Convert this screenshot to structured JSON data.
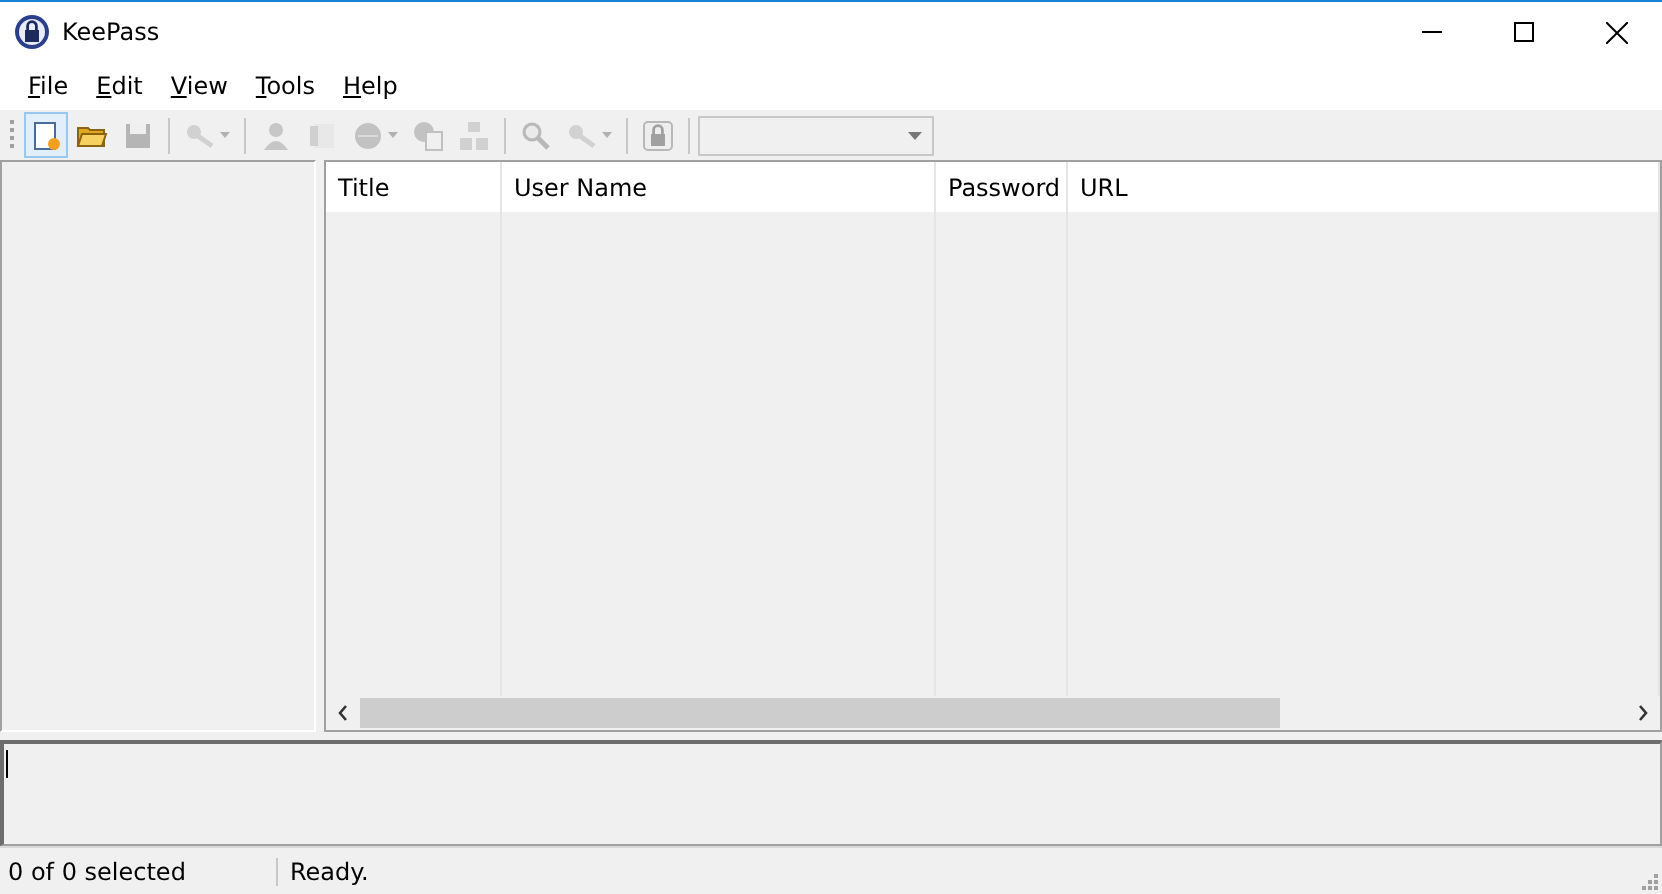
{
  "window": {
    "title": "KeePass"
  },
  "menu": [
    {
      "label": "File"
    },
    {
      "label": "Edit"
    },
    {
      "label": "View"
    },
    {
      "label": "Tools"
    },
    {
      "label": "Help"
    }
  ],
  "toolbar": [
    {
      "kind": "button",
      "disabled": false,
      "hovered": true
    },
    {
      "kind": "button",
      "disabled": false,
      "hovered": false
    },
    {
      "kind": "button",
      "disabled": true,
      "hovered": false
    },
    {
      "kind": "separator"
    },
    {
      "kind": "dropdown",
      "disabled": true,
      "hovered": false
    },
    {
      "kind": "separator"
    },
    {
      "kind": "button",
      "disabled": true,
      "hovered": false
    },
    {
      "kind": "button",
      "disabled": true,
      "hovered": false
    },
    {
      "kind": "dropdown",
      "disabled": true,
      "hovered": false
    },
    {
      "kind": "button",
      "disabled": true,
      "hovered": false
    },
    {
      "kind": "button",
      "disabled": true,
      "hovered": false
    },
    {
      "kind": "separator"
    },
    {
      "kind": "button",
      "disabled": true,
      "hovered": false
    },
    {
      "kind": "dropdown",
      "disabled": true,
      "hovered": false
    },
    {
      "kind": "separator"
    },
    {
      "kind": "button",
      "disabled": true,
      "hovered": false
    },
    {
      "kind": "separator"
    },
    {
      "kind": "combo",
      "disabled": true
    }
  ],
  "table": {
    "columns": [
      "Title",
      "User Name",
      "Password",
      "URL"
    ]
  },
  "status_bar": [
    "0 of 0 selected",
    "Ready."
  ]
}
